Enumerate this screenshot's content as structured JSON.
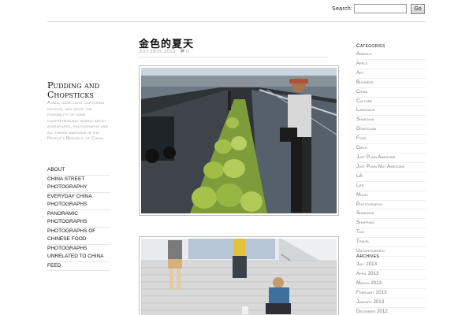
{
  "search": {
    "label": "Search:",
    "button": "Go",
    "value": ""
  },
  "site": {
    "title": "Pudding and Chopsticks",
    "description": "A man, some light capturing devices, and quite the possibility of some comprehensible words about adventures, photographs and all things awesome in the People's Republic of China."
  },
  "nav": [
    "ABOUT",
    "CHINA STREET PHOTOGRAPHY",
    "EVERYDAY CHINA PHOTOGRAPHS",
    "PANORAMIC PHOTOGRAPHS",
    "PHOTOGRAPHS OF CHINESE FOOD",
    "PHOTOGRAPHS UNRELATED TO CHINA",
    "FEED"
  ],
  "post": {
    "title": "金色的夏天",
    "date": "July 19th, 2013",
    "comments_icon": "comment-icon",
    "comments": "0"
  },
  "categories": {
    "heading": "Categories",
    "items": [
      "America",
      "Apple",
      "Art",
      "Business",
      "China",
      "Culture",
      "Language",
      "Shanghai",
      "Dongguan",
      "Food",
      "Girls",
      "Just Plain Awesome",
      "Just Plain Not Awesome",
      "LA",
      "Life",
      "Music",
      "Photographs",
      "Shanghai",
      "Shopping",
      "Taxi",
      "Travel",
      "Uncategorized"
    ]
  },
  "archives": {
    "heading": "Archives",
    "items": [
      "July 2013",
      "April 2013",
      "March 2013",
      "February 2013",
      "January 2013",
      "December 2012"
    ]
  },
  "colors": {
    "accent": "#111111",
    "muted": "#777777",
    "rule": "#d8d8d8"
  }
}
